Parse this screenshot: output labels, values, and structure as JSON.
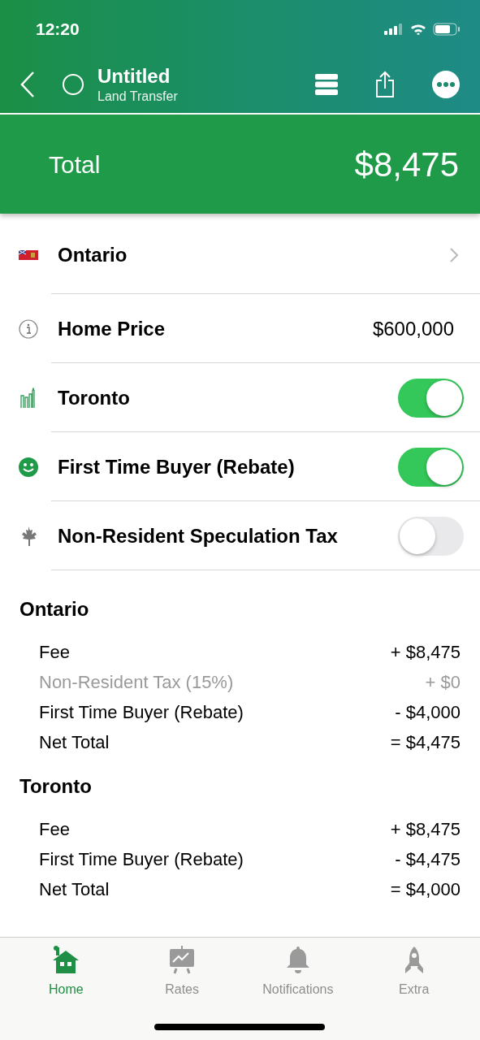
{
  "status_bar": {
    "time": "12:20"
  },
  "nav": {
    "title": "Untitled",
    "subtitle": "Land Transfer"
  },
  "total": {
    "label": "Total",
    "value": "$8,475"
  },
  "settings": [
    {
      "kind": "link",
      "label": "Ontario"
    },
    {
      "kind": "value",
      "label": "Home Price",
      "value": "$600,000"
    },
    {
      "kind": "toggle",
      "label": "Toronto",
      "on": true
    },
    {
      "kind": "toggle",
      "label": "First Time Buyer (Rebate)",
      "on": true
    },
    {
      "kind": "toggle",
      "label": "Non-Resident Speculation Tax",
      "on": false
    }
  ],
  "sections": [
    {
      "title": "Ontario",
      "lines": [
        {
          "label": "Fee",
          "amount": "+ $8,475",
          "disabled": false
        },
        {
          "label": "Non-Resident Tax (15%)",
          "amount": "+ $0",
          "disabled": true
        },
        {
          "label": "First Time Buyer (Rebate)",
          "amount": "- $4,000",
          "disabled": false
        },
        {
          "label": "Net Total",
          "amount": "= $4,475",
          "disabled": false
        }
      ]
    },
    {
      "title": "Toronto",
      "lines": [
        {
          "label": "Fee",
          "amount": "+ $8,475",
          "disabled": false
        },
        {
          "label": "First Time Buyer (Rebate)",
          "amount": "- $4,475",
          "disabled": false
        },
        {
          "label": "Net Total",
          "amount": "= $4,000",
          "disabled": false
        }
      ]
    }
  ],
  "tabs": [
    {
      "label": "Home",
      "selected": true
    },
    {
      "label": "Rates",
      "selected": false
    },
    {
      "label": "Notifications",
      "selected": false
    },
    {
      "label": "Extra",
      "selected": false
    }
  ]
}
